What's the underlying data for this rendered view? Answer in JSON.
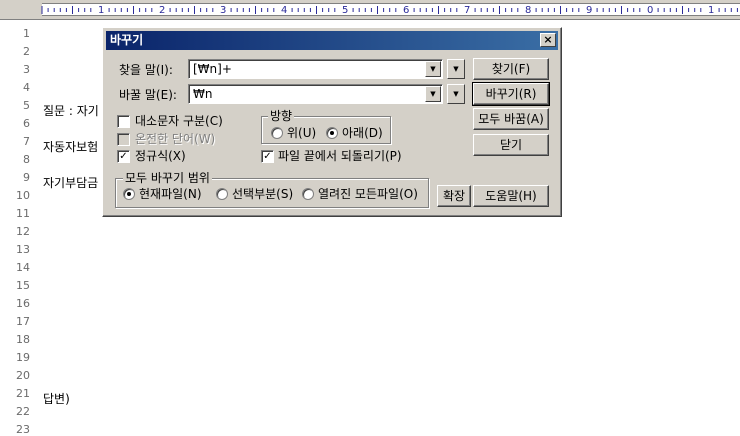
{
  "ruler": {
    "labels": [
      "1",
      "2",
      "3",
      "4",
      "5",
      "6",
      "7",
      "8",
      "9",
      "0",
      "1"
    ]
  },
  "editor": {
    "line_numbers": [
      "1",
      "2",
      "3",
      "4",
      "5",
      "6",
      "7",
      "8",
      "9",
      "10",
      "11",
      "12",
      "13",
      "14",
      "15",
      "16",
      "17",
      "18",
      "19",
      "20",
      "21",
      "22",
      "23"
    ],
    "lines": {
      "line6": "질문 : 자기",
      "line8": "자동자보험",
      "line10": "자기부담금",
      "line23": "답변)"
    }
  },
  "dialog": {
    "title": "바꾸기",
    "close_glyph": "×",
    "find_label": "찾을 말(I):",
    "find_value": "[₩n]+",
    "replace_label": "바꿀 말(E):",
    "replace_value": "₩n",
    "buttons": {
      "find": "찾기(F)",
      "replace": "바꾸기(R)",
      "replace_all": "모두 바꿈(A)",
      "close": "닫기",
      "expand": "확장",
      "help": "도움말(H)"
    },
    "options": {
      "case_sensitive": {
        "label": "대소문자 구분(C)",
        "checked": false
      },
      "whole_word": {
        "label": "온전한 단어(W)",
        "checked": false,
        "disabled": true
      },
      "regex": {
        "label": "정규식(X)",
        "checked": true
      },
      "wrap": {
        "label": "파일 끝에서 되돌리기(P)",
        "checked": true
      }
    },
    "direction": {
      "title": "방향",
      "up": "위(U)",
      "down": "아래(D)",
      "selected": "down"
    },
    "scope": {
      "title": "모두 바꾸기 범위",
      "current_file": "현재파일(N)",
      "selection": "선택부분(S)",
      "all_open": "열려진 모든파일(O)",
      "selected": "current_file"
    },
    "check_mark": "✓",
    "dropdown_glyph": "▼"
  }
}
